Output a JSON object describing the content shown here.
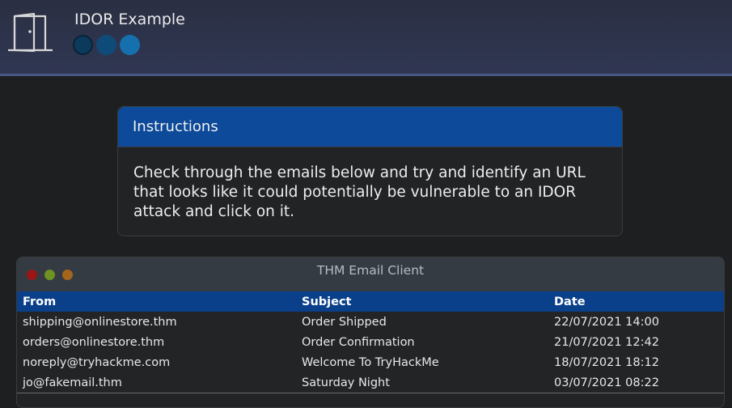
{
  "header": {
    "title": "IDOR Example",
    "icon": "door-icon",
    "indicator_colors": [
      "#0b3a5c",
      "#0f4b78",
      "#1570ad"
    ]
  },
  "instructions": {
    "heading": "Instructions",
    "body": "Check through the emails below and try and identify an URL that looks like it could potentially be vulnerable to an IDOR attack and click on it."
  },
  "email_client": {
    "title": "THM Email Client",
    "columns": {
      "from": "From",
      "subject": "Subject",
      "date": "Date"
    },
    "emails": [
      {
        "from": "shipping@onlinestore.thm",
        "subject": "Order Shipped",
        "date": "22/07/2021 14:00"
      },
      {
        "from": "orders@onlinestore.thm",
        "subject": "Order Confirmation",
        "date": "21/07/2021 12:42"
      },
      {
        "from": "noreply@tryhackme.com",
        "subject": "Welcome To TryHackMe",
        "date": "18/07/2021 18:12"
      },
      {
        "from": "jo@fakemail.thm",
        "subject": "Saturday Night",
        "date": "03/07/2021 08:22"
      }
    ]
  }
}
